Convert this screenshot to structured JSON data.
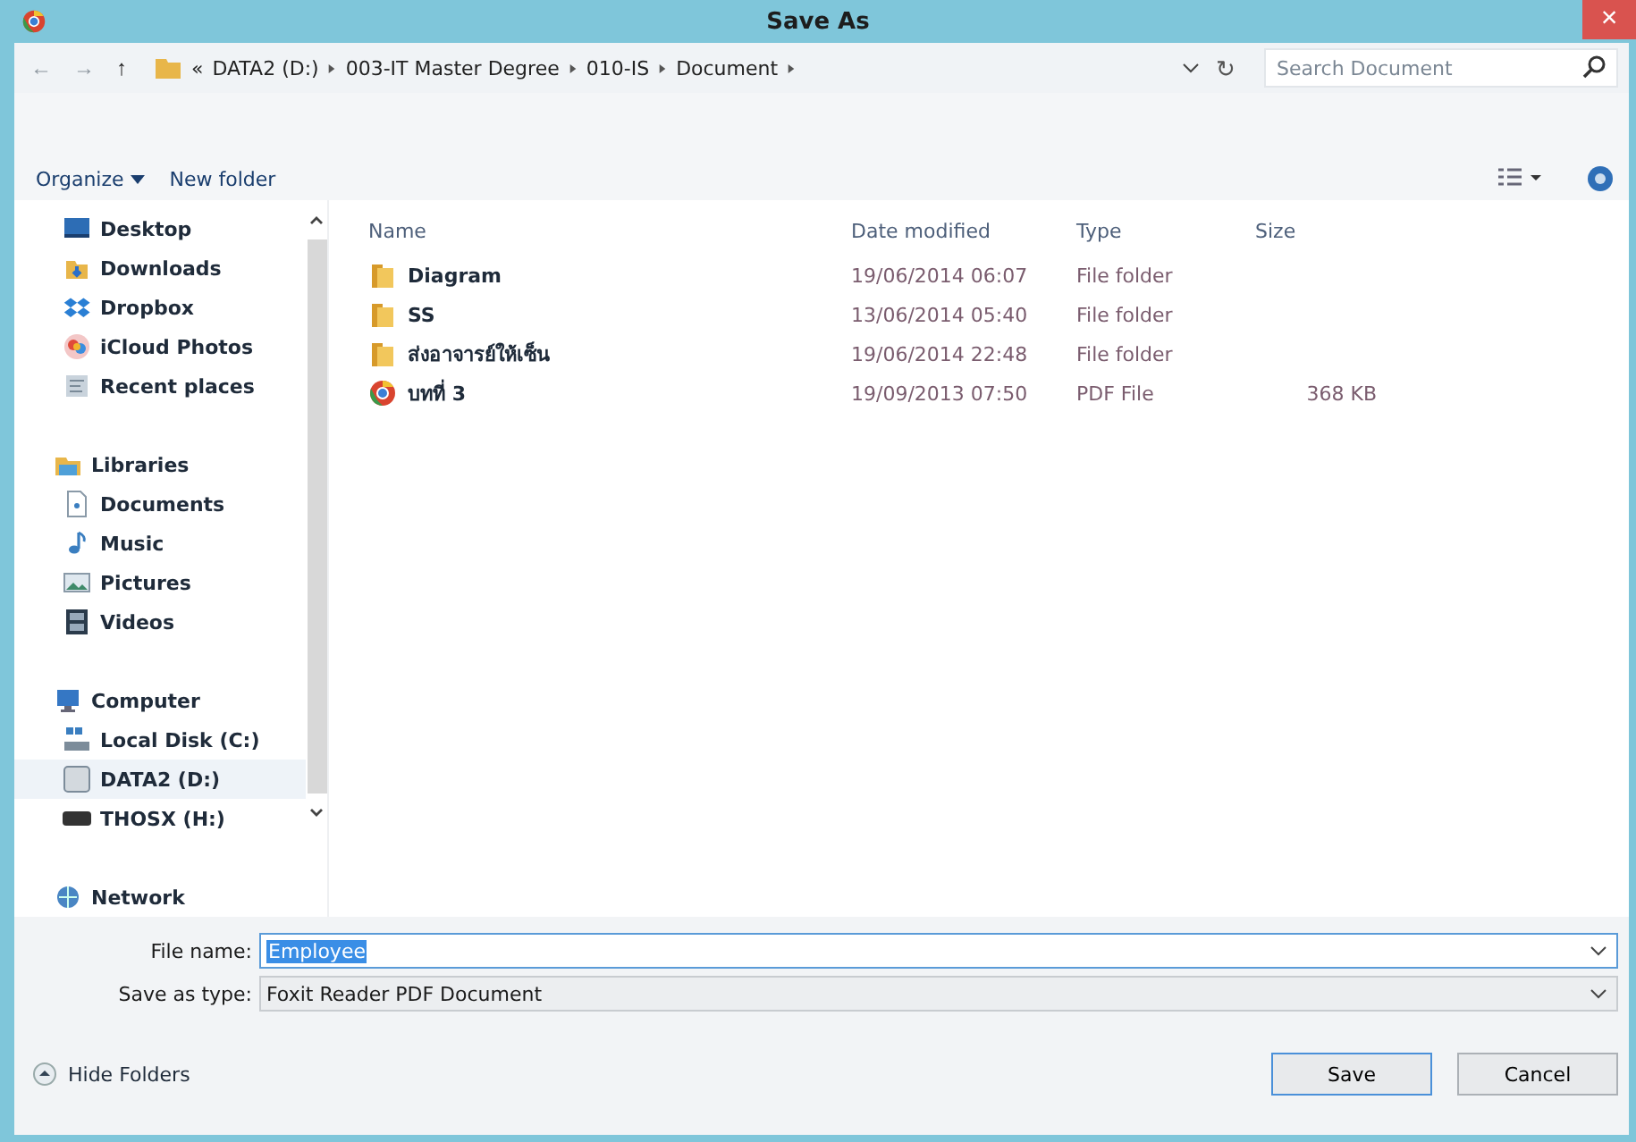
{
  "window": {
    "title": "Save As",
    "close": "×"
  },
  "address": {
    "back": "←",
    "forward": "→",
    "up": "↑",
    "overflow": "«",
    "path": [
      "DATA2 (D:)",
      "003-IT Master Degree",
      "010-IS",
      "Document"
    ],
    "refresh": "↻"
  },
  "search": {
    "placeholder": "Search Document"
  },
  "toolbar": {
    "organize": "Organize",
    "new_folder": "New folder"
  },
  "navigation": [
    {
      "kind": "item",
      "label": "Desktop",
      "selected": false
    },
    {
      "kind": "item",
      "label": "Downloads",
      "selected": false
    },
    {
      "kind": "item",
      "label": "Dropbox",
      "selected": false
    },
    {
      "kind": "item",
      "label": "iCloud Photos",
      "selected": false
    },
    {
      "kind": "item",
      "label": "Recent places",
      "selected": false
    },
    {
      "kind": "group",
      "label": "Libraries",
      "selected": false,
      "children": [
        {
          "label": "Documents",
          "selected": false
        },
        {
          "label": "Music",
          "selected": false
        },
        {
          "label": "Pictures",
          "selected": false
        },
        {
          "label": "Videos",
          "selected": false
        }
      ]
    },
    {
      "kind": "group",
      "label": "Computer",
      "selected": false,
      "children": [
        {
          "label": "Local Disk (C:)",
          "selected": false
        },
        {
          "label": "DATA2 (D:)",
          "selected": true
        },
        {
          "label": "THOSX (H:)",
          "selected": false
        }
      ]
    },
    {
      "kind": "group",
      "label": "Network",
      "selected": false
    }
  ],
  "table": {
    "columns": [
      "Name",
      "Date modified",
      "Type",
      "Size"
    ],
    "rows": [
      {
        "kind": "folder",
        "name": "Diagram",
        "date": "19/06/2014 06:07",
        "type": "File folder"
      },
      {
        "kind": "folder",
        "name": "SS",
        "date": "13/06/2014 05:40",
        "type": "File folder"
      },
      {
        "kind": "folder",
        "name": "ส่งอาจารย์ให้เซ็น",
        "date": "19/06/2014 22:48",
        "type": "File folder"
      },
      {
        "kind": "file",
        "name": "บทที่ 3",
        "date": "19/09/2013 07:50",
        "type": "PDF File",
        "size": "368 KB"
      }
    ]
  },
  "file_name": {
    "label": "File name:",
    "value": "Employee",
    "text_selected": true
  },
  "save_as_type": {
    "label": "Save as type:",
    "value": "Foxit Reader PDF Document"
  },
  "hide_folders": "Hide Folders",
  "buttons": [
    "Save",
    "Cancel"
  ]
}
